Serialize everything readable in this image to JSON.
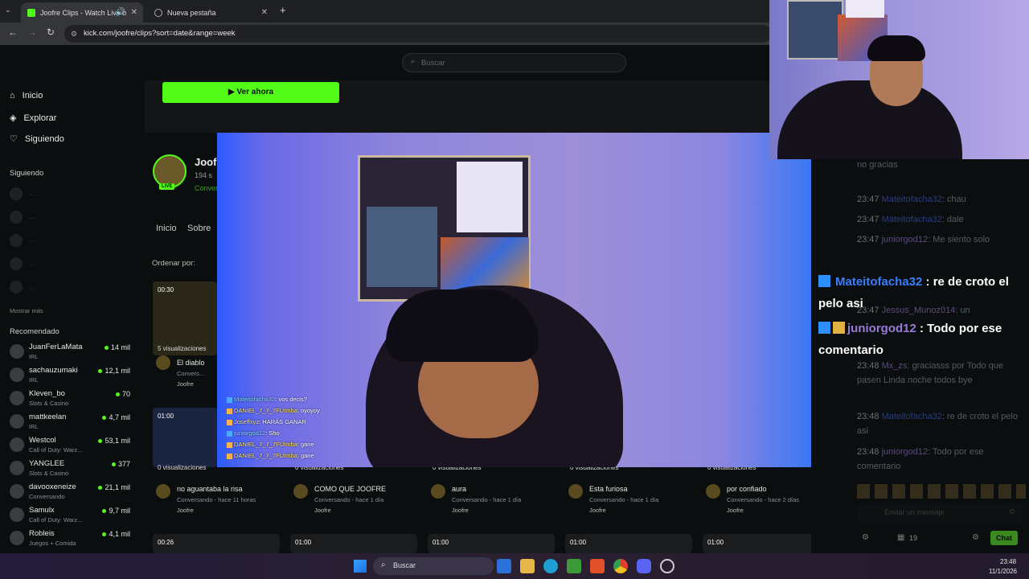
{
  "tabs": [
    {
      "label": "Joofre Clips - Watch Live o"
    },
    {
      "label": "Nueva pestaña"
    }
  ],
  "address": {
    "url": "kick.com/joofre/clips?sort=date&range=week"
  },
  "site": {
    "search_placeholder": "Buscar",
    "watch_now": "Ver ahora",
    "nav": [
      "Inicio",
      "Explorar",
      "Siguiendo"
    ],
    "following_header": "Siguiendo",
    "following": [
      "...",
      "...",
      "...",
      "...",
      "...",
      "..."
    ],
    "show_more": "Mostrar más",
    "recommended_header": "Recomendado",
    "recommended": [
      {
        "name": "JuanFerLaMata",
        "cat": "IRL",
        "viewers": "14 mil"
      },
      {
        "name": "sachauzumaki",
        "cat": "IRL",
        "viewers": "12,1 mil"
      },
      {
        "name": "Kleven_bo",
        "cat": "Slots & Casino",
        "viewers": "70"
      },
      {
        "name": "mattkeelan",
        "cat": "IRL",
        "viewers": "4,7 mil"
      },
      {
        "name": "Westcol",
        "cat": "Call of Duty: Warz...",
        "viewers": "53,1 mil"
      },
      {
        "name": "YANGLEE",
        "cat": "Slots & Casino",
        "viewers": "377"
      },
      {
        "name": "davooxeneize",
        "cat": "Conversando",
        "viewers": "21,1 mil"
      },
      {
        "name": "Samulx",
        "cat": "Call of Duty: Warz...",
        "viewers": "9,7 mil"
      },
      {
        "name": "Robleis",
        "cat": "Juegos + Comida",
        "viewers": "4,1 mil"
      }
    ],
    "channel": {
      "name": "Joof",
      "followers": "194 s",
      "status": "Convers",
      "live": "LIVE"
    },
    "channel_tabs": [
      "Inicio",
      "Sobre"
    ],
    "order_by": "Ordenar por:",
    "clips_top": [
      {
        "duration": "00:30",
        "views": "5 visualizaciones",
        "title": "El diablo",
        "meta": "Convers...",
        "user": "Joofre"
      },
      {
        "duration": "01:00",
        "views": "0 visualizaciones",
        "title": "",
        "meta": "",
        "user": ""
      }
    ],
    "clips": [
      {
        "views": "0 visualizaciones",
        "title": "no aguantaba la risa",
        "meta": "Conversando - hace 11 horas",
        "user": "Joofre"
      },
      {
        "views": "0 visualizaciones",
        "title": "COMO QUE JOOFRE",
        "meta": "Conversando - hace 1 día",
        "user": "Joofre"
      },
      {
        "views": "0 visualizaciones",
        "title": "aura",
        "meta": "Conversando - hace 1 día",
        "user": "Joofre"
      },
      {
        "views": "0 visualizaciones",
        "title": "Esta furiosa",
        "meta": "Conversando - hace 1 día",
        "user": "Joofre"
      },
      {
        "views": "0 visualizaciones",
        "title": "por confiado",
        "meta": "Conversando - hace 2 días",
        "user": "Joofre"
      }
    ],
    "clips_bottom_durations": [
      "00:26",
      "01:00",
      "01:00",
      "01:00",
      "01:00"
    ]
  },
  "video_overlay_chat": [
    {
      "user": "Mateitofacha32",
      "text": ": vos decis?"
    },
    {
      "user": "DANIEL_7_7_7FUImba",
      "text": ": oyoyoy"
    },
    {
      "user": "Joseffxyz",
      "text": ": HARÁS GANAR"
    },
    {
      "user": "juniorgod12",
      "text": ": Sho"
    },
    {
      "user": "DANIEL_7_7_7FUImba",
      "text": ": gane"
    },
    {
      "user": "DANIEL_7_7_7FUImba",
      "text": ": gane"
    }
  ],
  "chat": {
    "messages": [
      {
        "time": "",
        "user": "",
        "text": "no gracias"
      },
      {
        "time": "23:47",
        "user": "Mateitofacha32",
        "text": ": chau"
      },
      {
        "time": "23:47",
        "user": "Mateitofacha32",
        "text": ": dale"
      },
      {
        "time": "23:47",
        "user": "juniorgod12",
        "text": ": Me siento solo"
      },
      {
        "time": "23:47",
        "user": "Jessus_Munoz014",
        "text": ": un"
      },
      {
        "time": "23:48",
        "user": "Mx_zs",
        "text": ": graciasss por Todo que pasen Linda noche todos bye"
      },
      {
        "time": "23:48",
        "user": "Mateitofacha32",
        "text": ": re de croto el pelo asi"
      },
      {
        "time": "23:48",
        "user": "juniorgod12",
        "text": ": Todo por ese comentario"
      }
    ],
    "highlight": [
      {
        "user": "Mateitofacha32",
        "text": " : re de croto el pelo asi"
      },
      {
        "user": "juniorgod12",
        "text": " : Todo por ese comentario"
      }
    ],
    "input_placeholder": "Enviar un mensaje",
    "count": "19",
    "send_label": "Chat"
  },
  "taskbar": {
    "search": "Buscar",
    "time": "23:48",
    "date": "11/1/2026"
  }
}
